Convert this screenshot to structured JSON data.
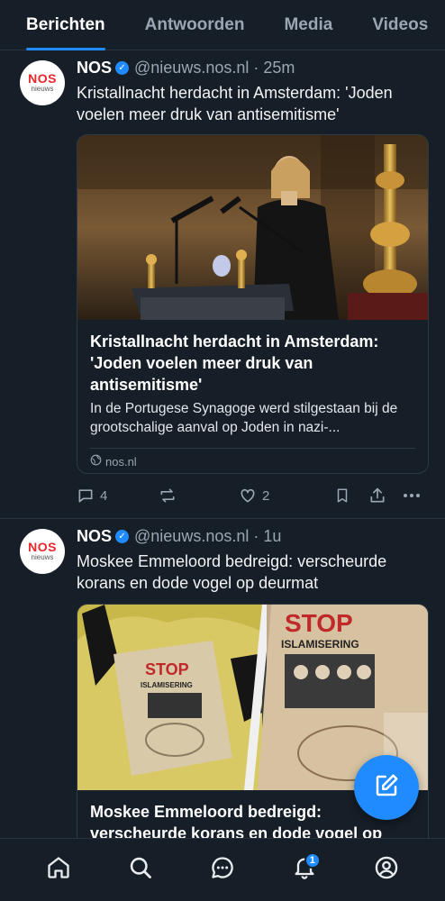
{
  "tabs": [
    {
      "label": "Berichten",
      "active": true
    },
    {
      "label": "Antwoorden",
      "active": false
    },
    {
      "label": "Media",
      "active": false
    },
    {
      "label": "Videos",
      "active": false
    }
  ],
  "posts": [
    {
      "author": "NOS",
      "avatar": {
        "brand": "NOS",
        "sub": "nieuws"
      },
      "handle": "@nieuws.nos.nl",
      "time": "· 25m",
      "text": "Kristallnacht herdacht in Amsterdam: 'Joden voelen meer druk van antisemitisme'",
      "card": {
        "title": "Kristallnacht herdacht in Amsterdam: 'Joden voelen meer druk van antisemitisme'",
        "description": "In de Portugese Synagoge werd stilgestaan bij de grootschalige aanval op Joden in nazi-...",
        "domain": "nos.nl"
      },
      "replies": "4",
      "reposts": "",
      "likes": "2"
    },
    {
      "author": "NOS",
      "avatar": {
        "brand": "NOS",
        "sub": "nieuws"
      },
      "handle": "@nieuws.nos.nl",
      "time": "· 1u",
      "text": "Moskee Emmeloord bedreigd: verscheurde korans en dode vogel op deurmat",
      "card": {
        "title": "Moskee Emmeloord bedreigd: verscheurde korans en dode vogel op",
        "image_text": {
          "stop": "STOP",
          "islam": "ISLAMISERING"
        }
      }
    }
  ],
  "nav": {
    "items": [
      "home-icon",
      "search-icon",
      "chat-icon",
      "bell-icon",
      "profile-icon"
    ],
    "notification_count": "1"
  },
  "colors": {
    "accent": "#208bfe",
    "background": "#161e27"
  }
}
